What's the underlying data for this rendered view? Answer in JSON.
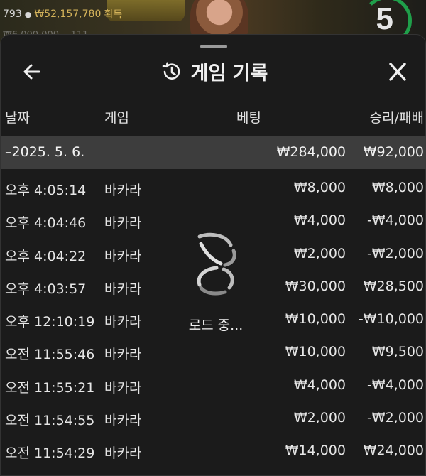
{
  "background": {
    "player_count": "793",
    "balance": "₩52,157,780",
    "earn_label": "획득",
    "secondary_text": "₩6,000,000 ...111",
    "countdown": "5"
  },
  "panel": {
    "title": "게임 기록",
    "columns": {
      "date": "날짜",
      "game": "게임",
      "bet": "베팅",
      "result": "승리/패배"
    },
    "group": {
      "date": "–2025. 5. 6.",
      "bet_total": "₩284,000",
      "result_total": "₩92,000"
    },
    "rows": [
      {
        "time": "오후 4:05:14",
        "game": "바카라",
        "bet": "₩8,000",
        "result": "₩8,000"
      },
      {
        "time": "오후 4:04:46",
        "game": "바카라",
        "bet": "₩4,000",
        "result": "-₩4,000"
      },
      {
        "time": "오후 4:04:22",
        "game": "바카라",
        "bet": "₩2,000",
        "result": "-₩2,000"
      },
      {
        "time": "오후 4:03:57",
        "game": "바카라",
        "bet": "₩30,000",
        "result": "₩28,500"
      },
      {
        "time": "오후 12:10:19",
        "game": "바카라",
        "bet": "₩10,000",
        "result": "-₩10,000"
      },
      {
        "time": "오전 11:55:46",
        "game": "바카라",
        "bet": "₩10,000",
        "result": "₩9,500"
      },
      {
        "time": "오전 11:55:21",
        "game": "바카라",
        "bet": "₩4,000",
        "result": "-₩4,000"
      },
      {
        "time": "오전 11:54:55",
        "game": "바카라",
        "bet": "₩2,000",
        "result": "-₩2,000"
      },
      {
        "time": "오전 11:54:29",
        "game": "바카라",
        "bet": "₩14,000",
        "result": "₩24,000"
      }
    ],
    "loading_text": "로드 중..."
  },
  "icons": {
    "back": "arrow-left-icon",
    "history": "history-clock-icon",
    "close": "close-icon",
    "person": "person-icon",
    "spinner": "loading-spinner-icon"
  },
  "colors": {
    "panel_bg": "#1b1b1b",
    "group_row_bg": "#3d3d3d",
    "gold": "#d4b35a",
    "countdown_ring": "#1f9f4a"
  }
}
